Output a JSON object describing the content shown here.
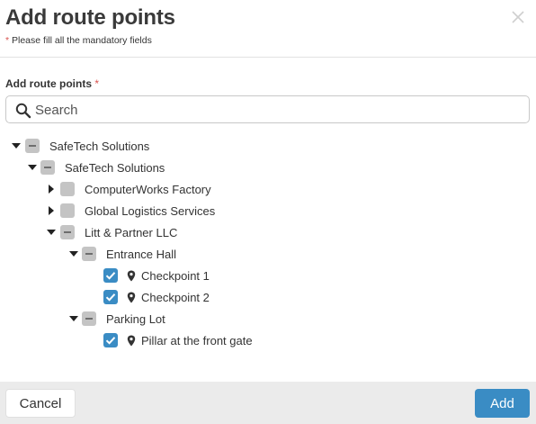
{
  "dialog": {
    "title": "Add route points",
    "mandatory_star": "*",
    "mandatory_note": " Please fill all the mandatory fields",
    "close_icon": "close-icon"
  },
  "field": {
    "label": "Add route points",
    "required_star": "*"
  },
  "search": {
    "placeholder": "Search",
    "value": ""
  },
  "tree": {
    "nodes": [
      {
        "label": "SafeTech Solutions",
        "state": "indeterminate",
        "expanded": true,
        "type": "group"
      },
      {
        "label": "SafeTech Solutions",
        "state": "indeterminate",
        "expanded": true,
        "type": "group"
      },
      {
        "label": "ComputerWorks Factory",
        "state": "unchecked",
        "expanded": false,
        "type": "group"
      },
      {
        "label": "Global Logistics Services",
        "state": "unchecked",
        "expanded": false,
        "type": "group"
      },
      {
        "label": "Litt & Partner LLC",
        "state": "indeterminate",
        "expanded": true,
        "type": "group"
      },
      {
        "label": "Entrance Hall",
        "state": "indeterminate",
        "expanded": true,
        "type": "group"
      },
      {
        "label": "Checkpoint 1",
        "state": "checked",
        "type": "point",
        "icon": "map-pin-icon"
      },
      {
        "label": "Checkpoint 2",
        "state": "checked",
        "type": "point",
        "icon": "map-pin-icon"
      },
      {
        "label": "Parking Lot",
        "state": "indeterminate",
        "expanded": true,
        "type": "group"
      },
      {
        "label": "Pillar at the front gate",
        "state": "checked",
        "type": "point",
        "icon": "map-pin-icon"
      }
    ]
  },
  "footer": {
    "cancel_label": "Cancel",
    "add_label": "Add"
  },
  "colors": {
    "accent": "#3a8cc4",
    "required": "#d9534f",
    "checkbox_inactive": "#c4c4c4",
    "footer_bg": "#ebebeb"
  }
}
